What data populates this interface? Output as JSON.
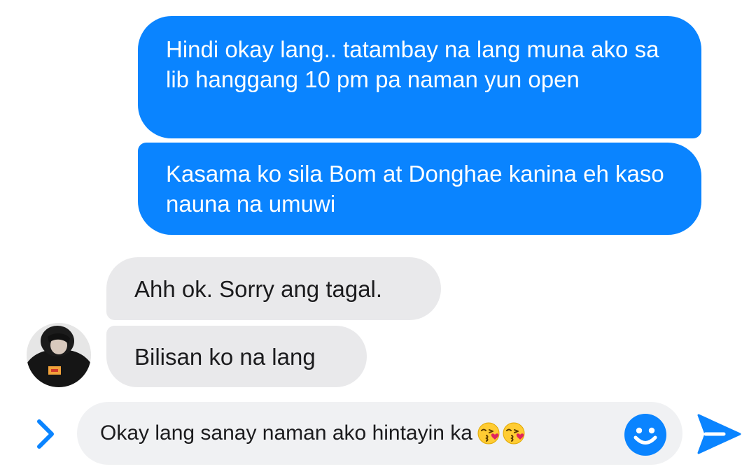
{
  "messages": {
    "sent": [
      {
        "text": "Hindi okay lang.. tatambay na lang muna ako sa lib hanggang 10 pm pa naman yun open"
      },
      {
        "text": "Kasama ko sila Bom at Donghae kanina eh kaso nauna na umuwi"
      }
    ],
    "received": [
      {
        "text": "Ahh ok. Sorry ang tagal."
      },
      {
        "text": "Bilisan ko na lang"
      }
    ]
  },
  "composer": {
    "value": "Okay lang sanay naman ako hintayin ka ",
    "emojis": [
      "kissing-face-with-heart",
      "kissing-face-with-heart"
    ]
  },
  "icons": {
    "expand": "chevron-right-icon",
    "emoji": "smiley-icon",
    "send": "send-icon",
    "avatar": "contact-avatar"
  },
  "colors": {
    "accent": "#0a84ff",
    "sent_bubble": "#0a84ff",
    "received_bubble": "#e9e9eb",
    "composer_bg": "#f0f1f3"
  }
}
